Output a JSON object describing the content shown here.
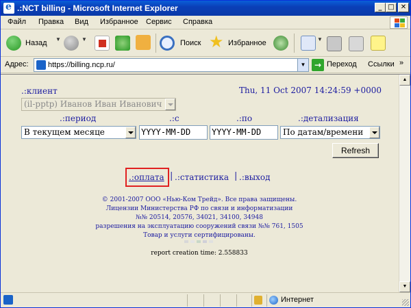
{
  "window": {
    "title": ".:NCT billing - Microsoft Internet Explorer"
  },
  "menu": {
    "items": [
      "Файл",
      "Правка",
      "Вид",
      "Избранное",
      "Сервис",
      "Справка"
    ]
  },
  "toolbar": {
    "back": "Назад",
    "search": "Поиск",
    "favorites": "Избранное"
  },
  "address": {
    "label": "Адрес:",
    "url": "https://billing.ncp.ru/",
    "go": "Переход",
    "links": "Ссылки",
    "links_more": "»"
  },
  "page": {
    "client_label": ".:клиент",
    "client_value": "(il-pptp) Иванов Иван Иванович",
    "datetime": "Thu, 11 Oct 2007 14:24:59 +0000",
    "period_label": ".:период",
    "from_label": ".:с",
    "to_label": ".:по",
    "detail_label": ".:детализация",
    "period_value": "В текущем месяце",
    "from_value": "YYYY-MM-DD",
    "to_value": "YYYY-MM-DD",
    "detail_value": "По датам/времени",
    "refresh": "Refresh",
    "nav": {
      "pay": ".:оплата",
      "stats": ".:статистика",
      "exit": ".:выход",
      "sep": "|"
    },
    "footer": [
      "© 2001-2007 ООО «Нью-Ком Трейд». Все права защищены.",
      "Лицензии Министерства РФ по связи и информатизации",
      "№№ 20514, 20576, 34021, 34100, 34948",
      "разрешения на эксплуатацию сооружений связи №№ 761, 1505",
      "Товар и услуги сертифицированы."
    ],
    "report_time": "report creation time: 2.558833"
  },
  "status": {
    "zone": "Интернет"
  },
  "colors": {
    "link": "#1a1aa0",
    "highlight": "#e02020",
    "titlebar": "#0a3fb8"
  }
}
